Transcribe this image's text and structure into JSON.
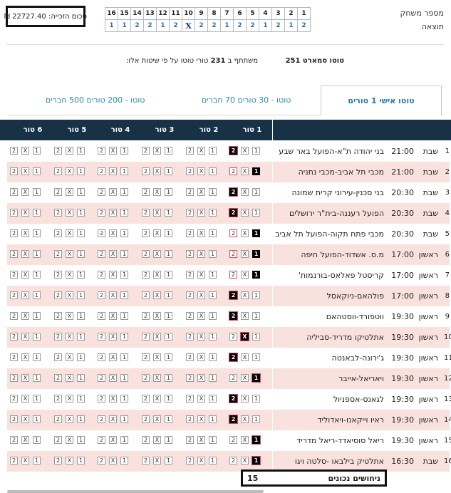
{
  "prize": {
    "label": "סכום הזכייה:",
    "amount": "22727.40",
    "currency": "₪"
  },
  "results": {
    "label_game": "מספר משחק",
    "label_result": "תוצאה",
    "games": [
      "16",
      "15",
      "14",
      "13",
      "12",
      "11",
      "10",
      "9",
      "8",
      "7",
      "6",
      "5",
      "4",
      "3",
      "2",
      "1"
    ],
    "outcomes": [
      "1",
      "1",
      "2",
      "2",
      "1",
      "2",
      "X",
      "2",
      "2",
      "1",
      "2",
      "2",
      "1",
      "2",
      "1",
      "2"
    ]
  },
  "toto": {
    "name": "טוטו סמארט 251",
    "info_prefix": "משתתף ב",
    "info_count": "231",
    "info_suffix": "טורי טוטו על פי שיטות אלו:"
  },
  "tabs": [
    "טוטו אישי 1 טורים",
    "טוטו - 30 טורים 70 חברים",
    "טוטו - 200 טורים 500 חברים"
  ],
  "columns": [
    "1 טור",
    "2 טור",
    "3 טור",
    "4 טור",
    "5 טור",
    "6 טור"
  ],
  "options": [
    "1",
    "X",
    "2"
  ],
  "rows": [
    {
      "n": "1",
      "day": "שבת",
      "time": "21:00",
      "match": "בני יהודה ת\"א-הפועל באר שבע",
      "pick": "2",
      "hit": "2"
    },
    {
      "n": "2",
      "day": "שבת",
      "time": "21:00",
      "match": "מכבי תל אביב-מכבי נתניה",
      "pick": "2",
      "hit": "1"
    },
    {
      "n": "3",
      "day": "שבת",
      "time": "20:30",
      "match": "בני סכנין-עירוני קרית שמונה",
      "pick": "2",
      "hit": "2"
    },
    {
      "n": "4",
      "day": "שבת",
      "time": "20:30",
      "match": "הפועל רעננה-בית\"ר ירושלים",
      "pick": "2",
      "hit": "2"
    },
    {
      "n": "5",
      "day": "שבת",
      "time": "20:30",
      "match": "מכבי פתח תקוה-הפועל תל אביב",
      "pick": "2",
      "hit": "1"
    },
    {
      "n": "6",
      "day": "ראשון",
      "time": "17:00",
      "match": "מ.ס. אשדוד-הפועל חיפה",
      "pick": "2",
      "hit": "1"
    },
    {
      "n": "7",
      "day": "ראשון",
      "time": "17:00",
      "match": "קריסטל פאלאס-בורנמות'",
      "pick": "2",
      "hit": "1"
    },
    {
      "n": "8",
      "day": "ראשון",
      "time": "17:00",
      "match": "פולהאם-ניוקאסל",
      "pick": "2",
      "hit": "2"
    },
    {
      "n": "9",
      "day": "ראשון",
      "time": "19:30",
      "match": "ווטפורד-ווסטהאם",
      "pick": "2",
      "hit": "2"
    },
    {
      "n": "10",
      "day": "ראשון",
      "time": "19:30",
      "match": "אתלטיקו מדריד-סביליה",
      "pick": "X",
      "hit": "X"
    },
    {
      "n": "11",
      "day": "ראשון",
      "time": "19:30",
      "match": "ג'ירונה-לבאנטה",
      "pick": "2",
      "hit": "2"
    },
    {
      "n": "12",
      "day": "ראשון",
      "time": "19:30",
      "match": "ויאריאל-אייבר",
      "pick": "1",
      "hit": "1"
    },
    {
      "n": "13",
      "day": "ראשון",
      "time": "19:30",
      "match": "לגאנס-אספניול",
      "pick": "2",
      "hit": "2"
    },
    {
      "n": "14",
      "day": "ראשון",
      "time": "19:30",
      "match": "ראיו וייקאנו-ויאדוליד",
      "pick": "2",
      "hit": "2"
    },
    {
      "n": "15",
      "day": "ראשון",
      "time": "19:30",
      "match": "ריאל סוסיאדד-ריאל מדריד",
      "pick": "1",
      "hit": "1"
    },
    {
      "n": "16",
      "day": "שבת",
      "time": "16:30",
      "match": "אתלטיק בילבאו -סלטה ויגו",
      "pick": "1",
      "hit": "1"
    }
  ],
  "correct": {
    "label": "ניחושים נכונים",
    "value": "15"
  }
}
